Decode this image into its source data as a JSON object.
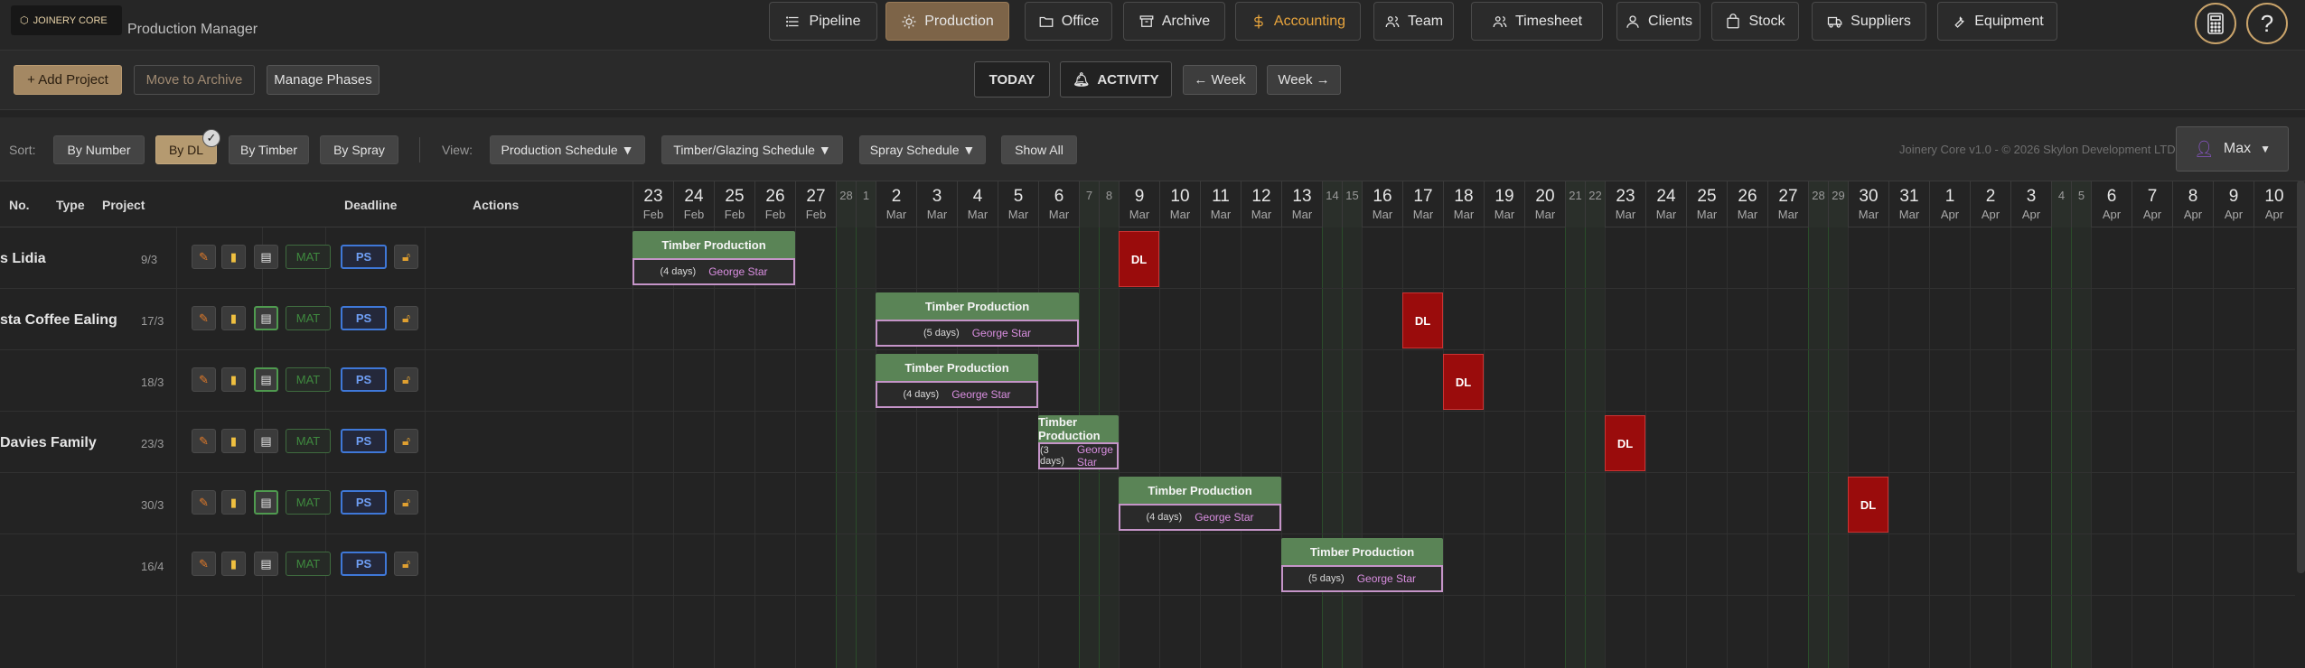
{
  "app": {
    "logo_text": "JOINERY CORE",
    "title": "Production Manager"
  },
  "nav": [
    {
      "label": "Pipeline",
      "icon": "list-icon"
    },
    {
      "label": "Production",
      "icon": "sun-icon",
      "active": true
    },
    {
      "label": "Office",
      "icon": "folder-icon"
    },
    {
      "label": "Archive",
      "icon": "archive-icon"
    },
    {
      "label": "Accounting",
      "icon": "dollar-icon",
      "accent": true
    },
    {
      "label": "Team",
      "icon": "team-icon"
    },
    {
      "label": "Timesheet",
      "icon": "timesheet-icon"
    },
    {
      "label": "Clients",
      "icon": "person-icon"
    },
    {
      "label": "Stock",
      "icon": "bag-icon"
    },
    {
      "label": "Suppliers",
      "icon": "truck-icon"
    },
    {
      "label": "Equipment",
      "icon": "wrench-icon"
    }
  ],
  "header_icons": {
    "calculator": "calculator-icon",
    "help": "?"
  },
  "toolbar": {
    "add_project": "+ Add Project",
    "move_archive": "Move to Archive",
    "manage_phases": "Manage Phases",
    "today": "TODAY",
    "activity": "ACTIVITY",
    "prev_week": "← Week",
    "next_week": "Week →"
  },
  "sortbar": {
    "sort_label": "Sort:",
    "sort_options": [
      "By Number",
      "By DL",
      "By Timber",
      "By Spray"
    ],
    "active_sort": "By DL",
    "view_label": "View:",
    "views": [
      "Production Schedule ▼",
      "Timber/Glazing Schedule ▼",
      "Spray Schedule ▼",
      "Show All"
    ],
    "copyright": "Joinery Core v1.0 - © 2026 Skylon Development LTD",
    "user": "Max"
  },
  "columns": {
    "no": "No.",
    "type": "Type",
    "project": "Project",
    "deadline": "Deadline",
    "actions": "Actions"
  },
  "days": [
    {
      "d": "23",
      "m": "Feb"
    },
    {
      "d": "24",
      "m": "Feb"
    },
    {
      "d": "25",
      "m": "Feb"
    },
    {
      "d": "26",
      "m": "Feb"
    },
    {
      "d": "27",
      "m": "Feb"
    },
    {
      "d": "28",
      "m": "",
      "wk": true
    },
    {
      "d": "1",
      "m": "",
      "wk": true
    },
    {
      "d": "2",
      "m": "Mar"
    },
    {
      "d": "3",
      "m": "Mar"
    },
    {
      "d": "4",
      "m": "Mar"
    },
    {
      "d": "5",
      "m": "Mar"
    },
    {
      "d": "6",
      "m": "Mar"
    },
    {
      "d": "7",
      "m": "",
      "wk": true
    },
    {
      "d": "8",
      "m": "",
      "wk": true
    },
    {
      "d": "9",
      "m": "Mar"
    },
    {
      "d": "10",
      "m": "Mar"
    },
    {
      "d": "11",
      "m": "Mar"
    },
    {
      "d": "12",
      "m": "Mar"
    },
    {
      "d": "13",
      "m": "Mar"
    },
    {
      "d": "14",
      "m": "",
      "wk": true
    },
    {
      "d": "15",
      "m": "",
      "wk": true
    },
    {
      "d": "16",
      "m": "Mar"
    },
    {
      "d": "17",
      "m": "Mar"
    },
    {
      "d": "18",
      "m": "Mar"
    },
    {
      "d": "19",
      "m": "Mar"
    },
    {
      "d": "20",
      "m": "Mar"
    },
    {
      "d": "21",
      "m": "",
      "wk": true
    },
    {
      "d": "22",
      "m": "",
      "wk": true
    },
    {
      "d": "23",
      "m": "Mar"
    },
    {
      "d": "24",
      "m": "Mar"
    },
    {
      "d": "25",
      "m": "Mar"
    },
    {
      "d": "26",
      "m": "Mar"
    },
    {
      "d": "27",
      "m": "Mar"
    },
    {
      "d": "28",
      "m": "",
      "wk": true
    },
    {
      "d": "29",
      "m": "",
      "wk": true
    },
    {
      "d": "30",
      "m": "Mar"
    },
    {
      "d": "31",
      "m": "Mar"
    },
    {
      "d": "1",
      "m": "Apr"
    },
    {
      "d": "2",
      "m": "Apr"
    },
    {
      "d": "3",
      "m": "Apr"
    },
    {
      "d": "4",
      "m": "",
      "wk": true
    },
    {
      "d": "5",
      "m": "",
      "wk": true
    },
    {
      "d": "6",
      "m": "Apr"
    },
    {
      "d": "7",
      "m": "Apr"
    },
    {
      "d": "8",
      "m": "Apr"
    },
    {
      "d": "9",
      "m": "Apr"
    },
    {
      "d": "10",
      "m": "Apr"
    }
  ],
  "rows": [
    {
      "name": "s Lidia",
      "deadline": "9/3",
      "task": {
        "title": "Timber Production",
        "days": "(4 days)",
        "who": "George Star",
        "start": 0,
        "len": 4
      },
      "dl": 14,
      "doc_green": false
    },
    {
      "name": "sta Coffee Ealing",
      "deadline": "17/3",
      "task": {
        "title": "Timber Production",
        "days": "(5 days)",
        "who": "George Star",
        "start": 7,
        "len": 5
      },
      "dl": 22,
      "doc_green": true
    },
    {
      "name": "",
      "deadline": "18/3",
      "task": {
        "title": "Timber Production",
        "days": "(4 days)",
        "who": "George Star",
        "start": 7,
        "len": 4
      },
      "dl": 23,
      "doc_green": true
    },
    {
      "name": " Davies Family",
      "deadline": "23/3",
      "task": {
        "title": "Timber Production",
        "days": "(3 days)",
        "who": "George Star",
        "start": 11,
        "len": 3
      },
      "dl": 28,
      "doc_green": false
    },
    {
      "name": "",
      "deadline": "30/3",
      "task": {
        "title": "Timber Production",
        "days": "(4 days)",
        "who": "George Star",
        "start": 14,
        "len": 4
      },
      "dl": 35,
      "doc_green": true
    },
    {
      "name": "",
      "deadline": "16/4",
      "task": {
        "title": "Timber Production",
        "days": "(5 days)",
        "who": "George Star",
        "start": 18,
        "len": 5
      },
      "dl": null,
      "doc_green": false
    }
  ],
  "row_buttons": {
    "mat": "MAT",
    "ps": "PS",
    "dl": "DL"
  }
}
